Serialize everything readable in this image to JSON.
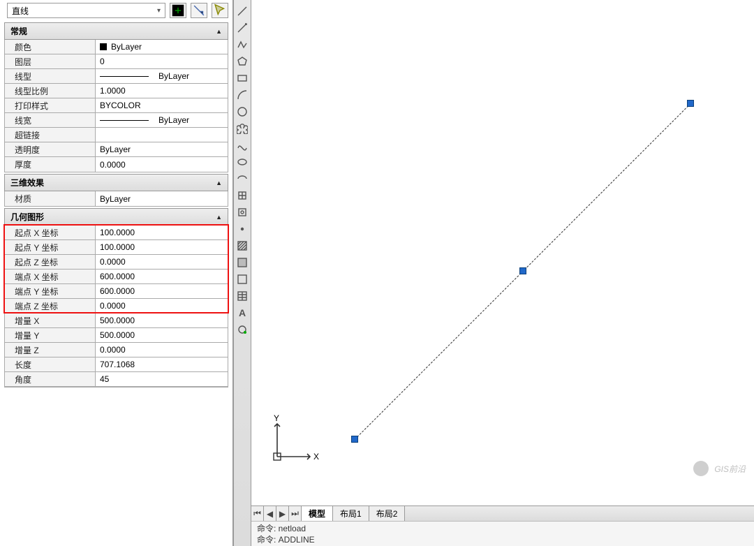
{
  "selector": {
    "value": "直线"
  },
  "categories": {
    "general": "常规",
    "threeD": "三维效果",
    "geometry": "几何图形"
  },
  "general": {
    "color_label": "颜色",
    "color_value": "ByLayer",
    "layer_label": "图层",
    "layer_value": "0",
    "linetype_label": "线型",
    "linetype_value": "ByLayer",
    "ltscale_label": "线型比例",
    "ltscale_value": "1.0000",
    "plotstyle_label": "打印样式",
    "plotstyle_value": "BYCOLOR",
    "lineweight_label": "线宽",
    "lineweight_value": "ByLayer",
    "hyperlink_label": "超链接",
    "hyperlink_value": "",
    "transparency_label": "透明度",
    "transparency_value": "ByLayer",
    "thickness_label": "厚度",
    "thickness_value": "0.0000"
  },
  "threeD": {
    "material_label": "材质",
    "material_value": "ByLayer"
  },
  "geometry": {
    "sx_label": "起点 X 坐标",
    "sx_value": "100.0000",
    "sy_label": "起点 Y 坐标",
    "sy_value": "100.0000",
    "sz_label": "起点 Z 坐标",
    "sz_value": "0.0000",
    "ex_label": "端点 X 坐标",
    "ex_value": "600.0000",
    "ey_label": "端点 Y 坐标",
    "ey_value": "600.0000",
    "ez_label": "端点 Z 坐标",
    "ez_value": "0.0000",
    "dx_label": "增量 X",
    "dx_value": "500.0000",
    "dy_label": "增量 Y",
    "dy_value": "500.0000",
    "dz_label": "增量 Z",
    "dz_value": "0.0000",
    "len_label": "长度",
    "len_value": "707.1068",
    "ang_label": "角度",
    "ang_value": "45"
  },
  "tabs": {
    "t1": "模型",
    "t2": "布局1",
    "t3": "布局2"
  },
  "cmd": {
    "l1": "命令: netload",
    "l2": "命令: ADDLINE"
  },
  "ucs": {
    "x": "X",
    "y": "Y"
  },
  "watermark": "GIS前沿",
  "highlight_color": "#e11"
}
